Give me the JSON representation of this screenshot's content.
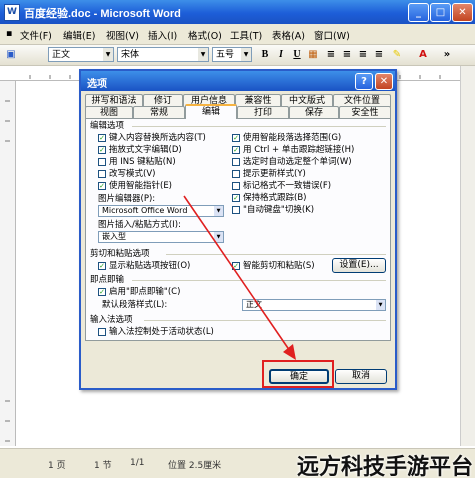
{
  "window": {
    "title": "百度经验.doc - Microsoft Word",
    "doc_icon": "W",
    "controls": [
      "_",
      "□",
      "✕"
    ]
  },
  "menubar": {
    "items": [
      "文件(F)",
      "编辑(E)",
      "视图(V)",
      "插入(I)",
      "格式(O)",
      "工具(T)",
      "表格(A)",
      "窗口(W)"
    ]
  },
  "toolbar": {
    "style": "正文",
    "font": "宋体",
    "size": "五号",
    "bold": "B",
    "italic": "I",
    "underline": "U",
    "font_color_letter": "A"
  },
  "dialog": {
    "title": "选项",
    "help": "?",
    "close": "✕",
    "tabs_row1": [
      "拼写和语法",
      "修订",
      "用户信息",
      "兼容性",
      "中文版式",
      "文件位置"
    ],
    "tabs_row2": [
      "视图",
      "常规",
      "编辑",
      "打印",
      "保存",
      "安全性"
    ],
    "active_tab": "编辑",
    "edit_options_header": "编辑选项",
    "left_options": [
      {
        "label": "键入内容替换所选内容(T)",
        "checked": true
      },
      {
        "label": "拖放式文字编辑(D)",
        "checked": true
      },
      {
        "label": "用 INS 键粘贴(N)",
        "checked": false
      },
      {
        "label": "改写模式(V)",
        "checked": false
      },
      {
        "label": "使用智能指针(E)",
        "checked": true
      }
    ],
    "right_options": [
      {
        "label": "使用智能段落选择范围(G)",
        "checked": true
      },
      {
        "label": "用 Ctrl + 单击跟踪超链接(H)",
        "checked": true
      },
      {
        "label": "选定时自动选定整个单词(W)",
        "checked": false
      },
      {
        "label": "提示更新样式(Y)",
        "checked": false
      },
      {
        "label": "标记格式不一致错误(F)",
        "checked": false
      },
      {
        "label": "保持格式跟踪(B)",
        "checked": true
      },
      {
        "label": "\"自动键盘\"切换(K)",
        "checked": false
      }
    ],
    "picture_editor_label": "图片编辑器(P):",
    "picture_editor_value": "Microsoft Office Word",
    "insert_paste_label": "图片插入/粘贴方式(I):",
    "insert_paste_value": "嵌入型",
    "cut_paste_header": "剪切和粘贴选项",
    "show_paste_buttons": {
      "label": "显示粘贴选项按钮(O)",
      "checked": true
    },
    "smart_cut_paste": {
      "label": "智能剪切和粘贴(S)",
      "checked": true
    },
    "settings_button": "设置(E)...",
    "click_type_header": "即点即输",
    "enable_click_type": {
      "label": "启用\"即点即输\"(C)",
      "checked": true
    },
    "default_para_label": "默认段落样式(L):",
    "default_para_value": "正文",
    "ime_header": "输入法选项",
    "ime_control": {
      "label": "输入法控制处于活动状态(L)",
      "checked": false
    },
    "ok_button": "确定",
    "cancel_button": "取消"
  },
  "statusbar": {
    "page": "1 页",
    "section": "1 节",
    "pages": "1/1",
    "position": "位置 2.5厘米"
  },
  "watermark": "远方科技手游平台",
  "colors": {
    "title_blue": "#1d5ed8",
    "chrome": "#ece9d8",
    "annotation_red": "#e02020"
  }
}
